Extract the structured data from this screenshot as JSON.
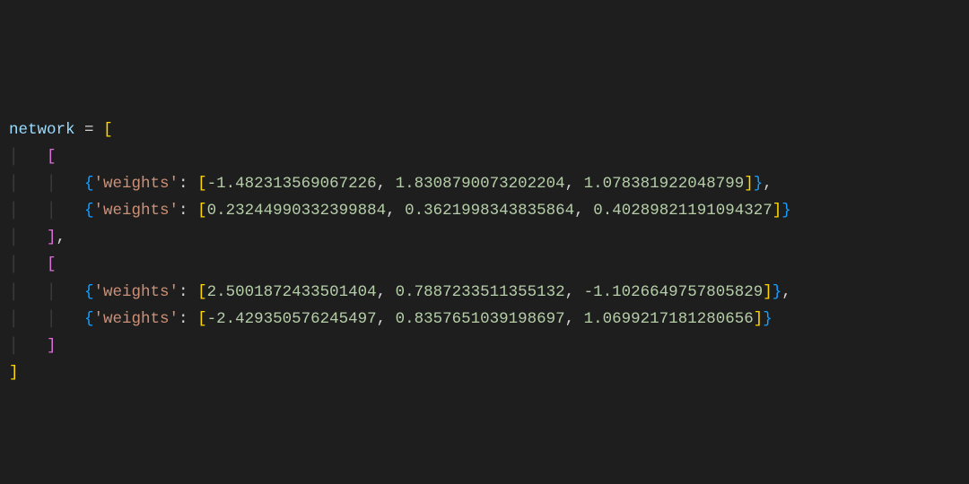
{
  "code": {
    "varName": "network",
    "assignOp": "=",
    "key": "'weights'",
    "layers": [
      {
        "rows": [
          {
            "values": [
              "-1.482313569067226",
              "1.8308790073202204",
              "1.078381922048799"
            ],
            "trailingComma": true
          },
          {
            "values": [
              "0.23244990332399884",
              "0.3621998343835864",
              "0.40289821191094327"
            ],
            "trailingComma": false
          }
        ],
        "trailingComma": true
      },
      {
        "rows": [
          {
            "values": [
              "2.5001872433501404",
              "0.7887233511355132",
              "-1.1026649757805829"
            ],
            "trailingComma": true
          },
          {
            "values": [
              "-2.429350576245497",
              "0.8357651039198697",
              "1.0699217181280656"
            ],
            "trailingComma": false
          }
        ],
        "trailingComma": false
      }
    ]
  }
}
